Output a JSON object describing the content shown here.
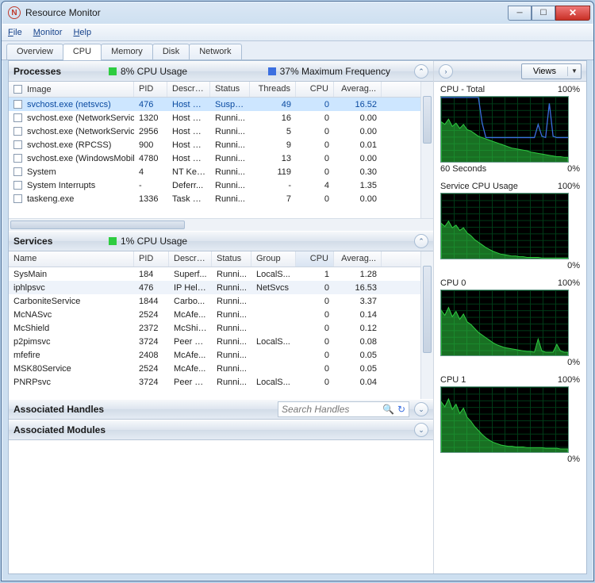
{
  "window": {
    "title": "Resource Monitor"
  },
  "menu": {
    "file": "File",
    "monitor": "Monitor",
    "help": "Help"
  },
  "tabs": {
    "overview": "Overview",
    "cpu": "CPU",
    "memory": "Memory",
    "disk": "Disk",
    "network": "Network"
  },
  "processes": {
    "title": "Processes",
    "cpu_usage": "8% CPU Usage",
    "max_freq": "37% Maximum Frequency",
    "cols": {
      "image": "Image",
      "pid": "PID",
      "desc": "Descrip...",
      "status": "Status",
      "threads": "Threads",
      "cpu": "CPU",
      "avg": "Averag..."
    },
    "rows": [
      {
        "image": "svchost.exe (netsvcs)",
        "pid": "476",
        "desc": "Host Pr...",
        "status": "Suspe...",
        "threads": "49",
        "cpu": "0",
        "avg": "16.52",
        "sel": true
      },
      {
        "image": "svchost.exe (NetworkService)",
        "pid": "1320",
        "desc": "Host Pr...",
        "status": "Runni...",
        "threads": "16",
        "cpu": "0",
        "avg": "0.00"
      },
      {
        "image": "svchost.exe (NetworkService...",
        "pid": "2956",
        "desc": "Host Pr...",
        "status": "Runni...",
        "threads": "5",
        "cpu": "0",
        "avg": "0.00"
      },
      {
        "image": "svchost.exe (RPCSS)",
        "pid": "900",
        "desc": "Host Pr...",
        "status": "Runni...",
        "threads": "9",
        "cpu": "0",
        "avg": "0.01"
      },
      {
        "image": "svchost.exe (WindowsMobile)",
        "pid": "4780",
        "desc": "Host Pr...",
        "status": "Runni...",
        "threads": "13",
        "cpu": "0",
        "avg": "0.00"
      },
      {
        "image": "System",
        "pid": "4",
        "desc": "NT Ker...",
        "status": "Runni...",
        "threads": "119",
        "cpu": "0",
        "avg": "0.30"
      },
      {
        "image": "System Interrupts",
        "pid": "-",
        "desc": "Deferr...",
        "status": "Runni...",
        "threads": "-",
        "cpu": "4",
        "avg": "1.35"
      },
      {
        "image": "taskeng.exe",
        "pid": "1336",
        "desc": "Task Sc...",
        "status": "Runni...",
        "threads": "7",
        "cpu": "0",
        "avg": "0.00"
      }
    ]
  },
  "services": {
    "title": "Services",
    "cpu_usage": "1% CPU Usage",
    "cols": {
      "name": "Name",
      "pid": "PID",
      "desc": "Descrip...",
      "status": "Status",
      "group": "Group",
      "cpu": "CPU",
      "avg": "Averag..."
    },
    "rows": [
      {
        "name": "SysMain",
        "pid": "184",
        "desc": "Superf...",
        "status": "Runni...",
        "group": "LocalS...",
        "cpu": "1",
        "avg": "1.28"
      },
      {
        "name": "iphlpsvc",
        "pid": "476",
        "desc": "IP Helper",
        "status": "Runni...",
        "group": "NetSvcs",
        "cpu": "0",
        "avg": "16.53"
      },
      {
        "name": "CarboniteService",
        "pid": "1844",
        "desc": "Carbo...",
        "status": "Runni...",
        "group": "",
        "cpu": "0",
        "avg": "3.37"
      },
      {
        "name": "McNASvc",
        "pid": "2524",
        "desc": "McAfe...",
        "status": "Runni...",
        "group": "",
        "cpu": "0",
        "avg": "0.14"
      },
      {
        "name": "McShield",
        "pid": "2372",
        "desc": "McShie...",
        "status": "Runni...",
        "group": "",
        "cpu": "0",
        "avg": "0.12"
      },
      {
        "name": "p2pimsvc",
        "pid": "3724",
        "desc": "Peer N...",
        "status": "Runni...",
        "group": "LocalS...",
        "cpu": "0",
        "avg": "0.08"
      },
      {
        "name": "mfefire",
        "pid": "2408",
        "desc": "McAfe...",
        "status": "Runni...",
        "group": "",
        "cpu": "0",
        "avg": "0.05"
      },
      {
        "name": "MSK80Service",
        "pid": "2524",
        "desc": "McAfe...",
        "status": "Runni...",
        "group": "",
        "cpu": "0",
        "avg": "0.05"
      },
      {
        "name": "PNRPsvc",
        "pid": "3724",
        "desc": "Peer N...",
        "status": "Runni...",
        "group": "LocalS...",
        "cpu": "0",
        "avg": "0.04"
      }
    ]
  },
  "handles": {
    "title": "Associated Handles",
    "search_placeholder": "Search Handles"
  },
  "modules": {
    "title": "Associated Modules"
  },
  "right": {
    "views": "Views",
    "charts": [
      {
        "title": "CPU - Total",
        "max": "100%",
        "footL": "60 Seconds",
        "footR": "0%"
      },
      {
        "title": "Service CPU Usage",
        "max": "100%",
        "footL": "",
        "footR": "0%"
      },
      {
        "title": "CPU 0",
        "max": "100%",
        "footL": "",
        "footR": "0%"
      },
      {
        "title": "CPU 1",
        "max": "100%",
        "footL": "",
        "footR": "0%"
      }
    ]
  },
  "chart_data": [
    {
      "type": "area",
      "title": "CPU - Total",
      "ylim": [
        0,
        100
      ],
      "x_seconds": 60,
      "series": [
        {
          "name": "cpu",
          "color": "#2ecc40",
          "values": [
            62,
            58,
            66,
            55,
            60,
            52,
            58,
            50,
            48,
            44,
            40,
            38,
            36,
            34,
            32,
            30,
            28,
            26,
            24,
            22,
            21,
            20,
            19,
            18,
            16,
            15,
            14,
            13,
            12,
            11,
            10,
            9,
            9,
            8,
            8
          ]
        },
        {
          "name": "max-freq",
          "color": "#3b6fe0",
          "values": [
            99,
            99,
            99,
            99,
            99,
            99,
            99,
            99,
            99,
            99,
            99,
            60,
            38,
            38,
            38,
            38,
            38,
            38,
            38,
            38,
            38,
            38,
            38,
            38,
            38,
            38,
            58,
            40,
            38,
            90,
            40,
            38,
            38,
            38,
            38
          ]
        }
      ]
    },
    {
      "type": "area",
      "title": "Service CPU Usage",
      "ylim": [
        0,
        100
      ],
      "x_seconds": 60,
      "series": [
        {
          "name": "cpu",
          "color": "#2ecc40",
          "values": [
            55,
            50,
            58,
            48,
            52,
            44,
            48,
            40,
            36,
            30,
            26,
            22,
            18,
            15,
            12,
            10,
            8,
            7,
            6,
            5,
            5,
            4,
            4,
            3,
            3,
            3,
            3,
            2,
            2,
            2,
            2,
            2,
            2,
            2,
            2
          ]
        }
      ]
    },
    {
      "type": "area",
      "title": "CPU 0",
      "ylim": [
        0,
        100
      ],
      "x_seconds": 60,
      "series": [
        {
          "name": "cpu",
          "color": "#2ecc40",
          "values": [
            70,
            62,
            74,
            60,
            68,
            56,
            64,
            52,
            48,
            42,
            36,
            32,
            28,
            24,
            20,
            17,
            15,
            13,
            12,
            11,
            10,
            9,
            8,
            7,
            7,
            6,
            26,
            8,
            6,
            6,
            6,
            18,
            8,
            6,
            6
          ]
        }
      ]
    },
    {
      "type": "area",
      "title": "CPU 1",
      "ylim": [
        0,
        100
      ],
      "x_seconds": 60,
      "series": [
        {
          "name": "cpu",
          "color": "#2ecc40",
          "values": [
            78,
            70,
            82,
            66,
            74,
            60,
            68,
            54,
            48,
            40,
            34,
            28,
            23,
            19,
            16,
            14,
            12,
            11,
            10,
            10,
            9,
            9,
            9,
            8,
            8,
            8,
            8,
            8,
            7,
            7,
            7,
            7,
            6,
            6,
            6
          ]
        }
      ]
    }
  ]
}
